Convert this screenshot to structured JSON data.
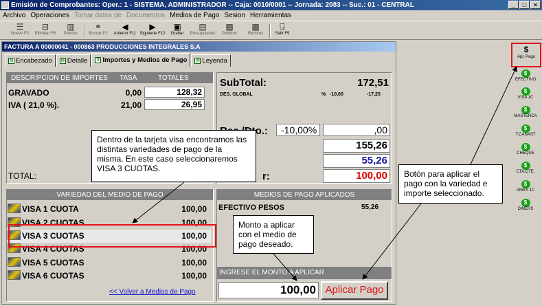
{
  "window": {
    "title": "Emisión de Comprobantes:  Oper.: 1 - SISTEMA, ADMINISTRADOR  --  Caja: 0010/0001  --  Jornada: 2083  --  Suc.: 01 - CENTRAL",
    "minimize": "_",
    "maximize": "□",
    "close": "×"
  },
  "menu": {
    "archivo": "Archivo",
    "operaciones": "Operaciones",
    "tomar_datos": "Tomar datos de",
    "documentos": "Documentos",
    "medios_pago": "Medios de Pago",
    "sesion": "Sesion",
    "herramientas": "Herramientas"
  },
  "toolbar": {
    "nuevo": "Nuevo F3",
    "eliminar": "Eliminar F6",
    "precios": "Precios",
    "buscar": "Buscar F2",
    "anterior": "Anterior F11",
    "siguiente": "Siguiente F12",
    "grabar": "Grabar",
    "presupuestos": "Presupuestos",
    "pedidos": "Pedidos",
    "remitos": "Remitos",
    "salir": "Salir F9"
  },
  "doc": {
    "title": "FACTURA  A  00000041  -  000863  PRODUCCIONES INTEGRALES S.A"
  },
  "tabs": {
    "encabezado": "Encabezado",
    "detalle": "Detalle",
    "importes": "Importes y Medios de Pago",
    "leyenda": "Leyenda"
  },
  "importes": {
    "col_desc": "DESCRIPCION DE IMPORTES",
    "col_tasa": "TASA",
    "col_totales": "TOTALES",
    "rows": [
      {
        "desc": "GRAVADO",
        "tasa": "0,00",
        "total": "128,32"
      },
      {
        "desc": "IVA  ( 21,0 %).",
        "tasa": "21,00",
        "total": "26,95"
      }
    ],
    "total_label": "TOTAL:"
  },
  "summary": {
    "subtotal_label": "SubTotal:",
    "subtotal_value": "172,51",
    "des_global_label": "DES. GLOBAL",
    "des_pct_symbol": "%",
    "des_pct": "-10,00",
    "des_value": "-17,25",
    "rec_label": "Rec./Dto.:",
    "rec_pct": "-10,00%",
    "rec_value": ",00",
    "total_value": "155,26",
    "pagado_value": "55,26",
    "restante_label": "r:",
    "restante_value": "100,00"
  },
  "variedad": {
    "header": "VARIEDAD DEL MEDIO DE PAGO",
    "items": [
      {
        "name": "VISA 1 CUOTA",
        "amount": "100,00"
      },
      {
        "name": "VISA 2 CUOTAS",
        "amount": "100,00"
      },
      {
        "name": "VISA 3 CUOTAS",
        "amount": "100,00"
      },
      {
        "name": "VISA 4 CUOTAS",
        "amount": "100,00"
      },
      {
        "name": "VISA 5 CUOTAS",
        "amount": "100,00"
      },
      {
        "name": "VISA 6 CUOTAS",
        "amount": "100,00"
      }
    ],
    "back_link": "<< Volver a Medios de Pago"
  },
  "aplicados": {
    "header": "MEDIOS DE PAGO APLICADOS",
    "items": [
      {
        "name": "EFECTIVO PESOS",
        "amount": "55,26"
      }
    ]
  },
  "ingreso": {
    "header": "INGRESE EL MONTO A APLICAR",
    "value": "100,00",
    "apply_button": "Aplicar Pago"
  },
  "side": {
    "apl_pago_symbol": "$",
    "apl_pago": "Apl. Pago",
    "methods": [
      "EFECTIVO",
      "VISA 1C",
      "MASTERCA",
      "T.CANAST",
      "CHEQUE",
      "CTA.CTE.",
      "AMEX 1C",
      "DINERS"
    ]
  },
  "callouts": {
    "visa": "Dentro de la tarjeta visa encontramos las distintas variedades de pago de la misma. En este caso seleccionaremos VISA 3 CUOTAS.",
    "monto": "Monto a aplicar con el medio de pago deseado.",
    "boton": "Botón para aplicar el pago con la variedad e importe seleccionado."
  },
  "colors": {
    "title_blue": "#0a246a",
    "selection_red": "#e0141a",
    "pagado_blue": "#1a1aa0",
    "restante_red": "#dd0000",
    "link_blue": "#1a1ad0"
  }
}
